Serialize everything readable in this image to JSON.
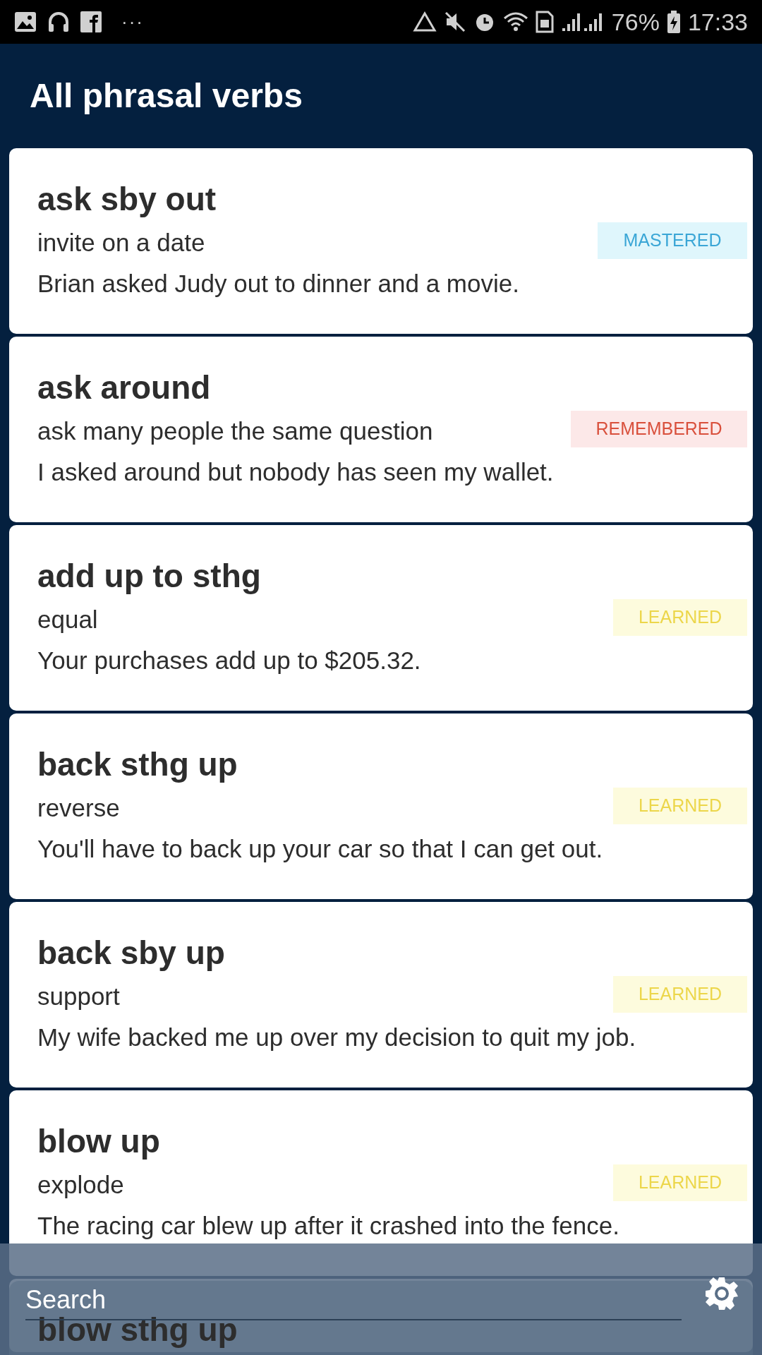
{
  "status_bar": {
    "more": "···",
    "battery": "76%",
    "time": "17:33"
  },
  "app_bar": {
    "title": "All phrasal verbs"
  },
  "verbs": [
    {
      "phrase": "ask sby out",
      "meaning": "invite on a date",
      "example": "Brian asked Judy out to dinner and a movie.",
      "status": {
        "kind": "mastered",
        "label": "MASTERED"
      }
    },
    {
      "phrase": "ask around",
      "meaning": "ask many people the same question",
      "example": "I asked around but nobody has seen my wallet.",
      "status": {
        "kind": "remembered",
        "label": "REMEMBERED"
      }
    },
    {
      "phrase": "add up to sthg",
      "meaning": "equal",
      "example": "Your purchases add up to $205.32.",
      "status": {
        "kind": "learned",
        "label": "LEARNED"
      }
    },
    {
      "phrase": "back sthg up",
      "meaning": "reverse",
      "example": "You'll have to back up your car so that I can get out.",
      "status": {
        "kind": "learned",
        "label": "LEARNED"
      }
    },
    {
      "phrase": "back sby up",
      "meaning": "support",
      "example": "My wife backed me up over my decision to quit my job.",
      "status": {
        "kind": "learned",
        "label": "LEARNED"
      }
    },
    {
      "phrase": "blow up",
      "meaning": "explode",
      "example": "The racing car blew up after it crashed into the fence.",
      "status": {
        "kind": "learned",
        "label": "LEARNED"
      }
    },
    {
      "phrase": "blow sthg up"
    }
  ],
  "search": {
    "placeholder": "Search"
  }
}
